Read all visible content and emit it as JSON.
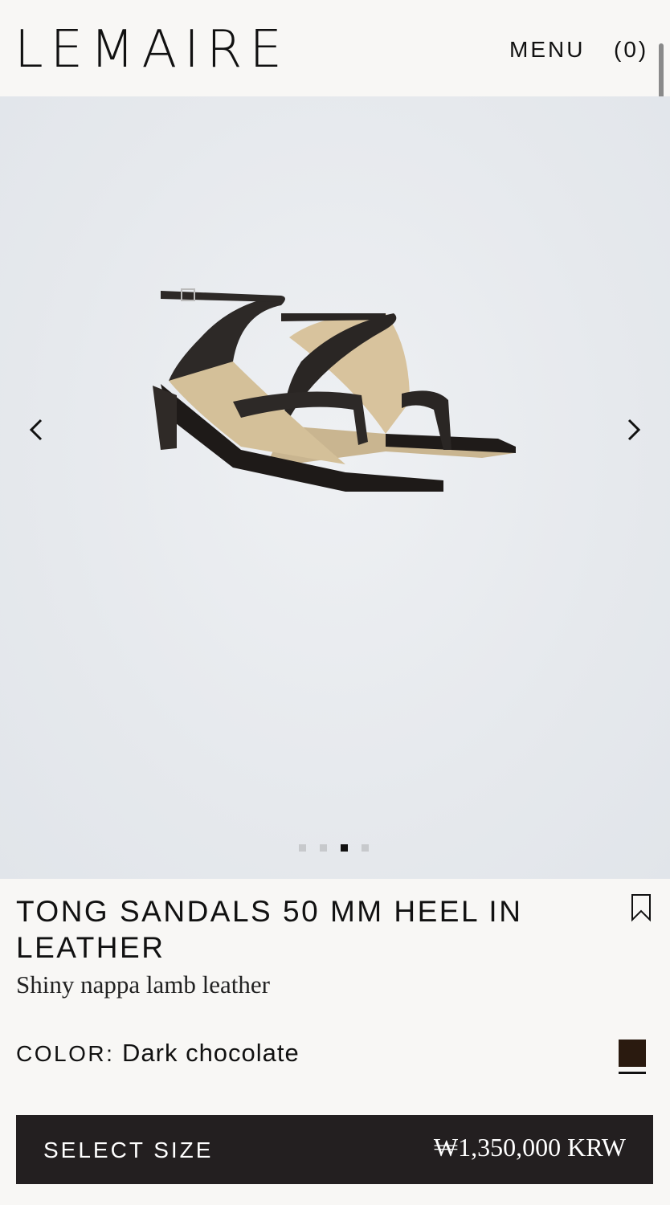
{
  "header": {
    "logo": "LEMAIRE",
    "menu_label": "MENU",
    "cart_label": "(0)"
  },
  "gallery": {
    "slide_count": 4,
    "active_slide": 3,
    "prev_icon": "chevron-left-icon",
    "next_icon": "chevron-right-icon"
  },
  "product": {
    "title": "TONG SANDALS 50 MM HEEL IN LEATHER",
    "subtitle": "Shiny nappa lamb leather",
    "color_label": "COLOR:",
    "color_value": "Dark chocolate",
    "swatch_color": "#2a1a0f",
    "bookmark_icon": "bookmark-icon"
  },
  "purchase": {
    "select_size_label": "SELECT SIZE",
    "price": "₩1,350,000 KRW"
  },
  "colors": {
    "background": "#f8f7f5",
    "button": "#231f20",
    "text": "#111111"
  }
}
